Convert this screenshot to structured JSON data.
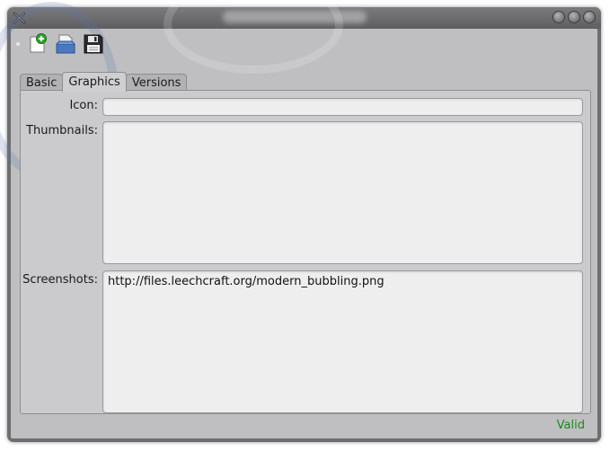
{
  "toolbar": {
    "buttons": [
      {
        "name": "new-document",
        "icon": "document-new-icon"
      },
      {
        "name": "open-document",
        "icon": "document-open-icon"
      },
      {
        "name": "save-document",
        "icon": "floppy-save-icon"
      }
    ]
  },
  "tabs": [
    {
      "label": "Basic",
      "active": false
    },
    {
      "label": "Graphics",
      "active": true
    },
    {
      "label": "Versions",
      "active": false
    }
  ],
  "graphics": {
    "icon_label": "Icon:",
    "icon_value": "",
    "thumbnails_label": "Thumbnails:",
    "thumbnails_value": "",
    "screenshots_label": "Screenshots:",
    "screenshots_value": "http://files.leechcraft.org/modern_bubbling.png"
  },
  "status": {
    "text": "Valid",
    "color": "#1a8a1a"
  },
  "colors": {
    "window_frame": "#6e6e70",
    "client_bg": "#bfbfc1",
    "field_bg": "#eeeeee"
  }
}
